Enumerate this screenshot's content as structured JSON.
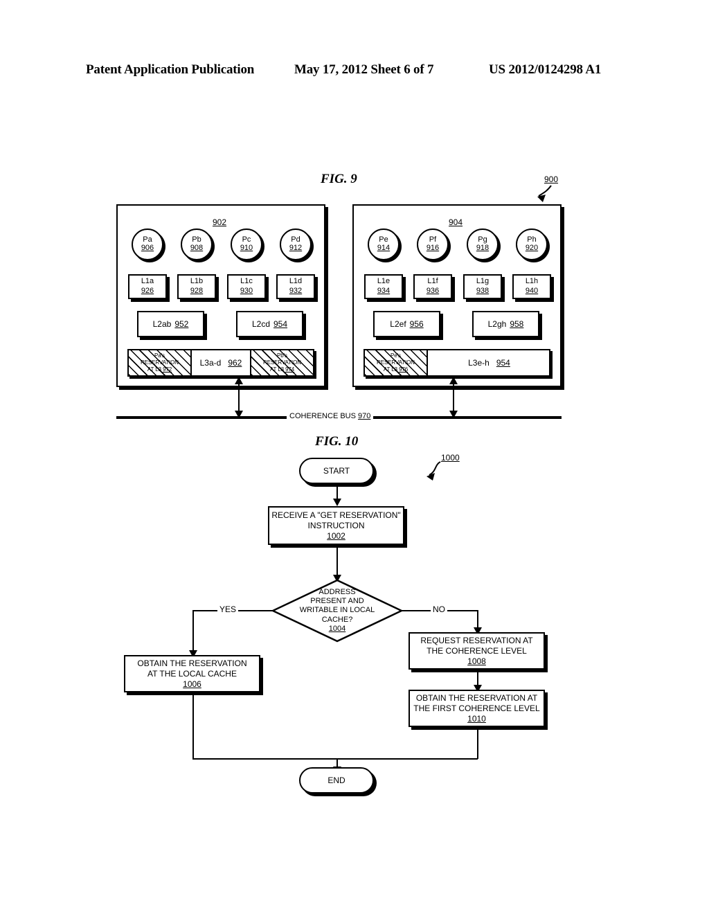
{
  "header": {
    "left": "Patent Application Publication",
    "center": "May 17, 2012  Sheet 6 of 7",
    "right": "US 2012/0124298 A1"
  },
  "fig9": {
    "title": "FIG. 9",
    "system_ref": "900",
    "clusters": [
      {
        "id": "902",
        "processors": [
          {
            "name": "Pa",
            "ref": "906"
          },
          {
            "name": "Pb",
            "ref": "908"
          },
          {
            "name": "Pc",
            "ref": "910"
          },
          {
            "name": "Pd",
            "ref": "912"
          }
        ],
        "l1_caches": [
          {
            "name": "L1a",
            "ref": "926"
          },
          {
            "name": "L1b",
            "ref": "928"
          },
          {
            "name": "L1c",
            "ref": "930"
          },
          {
            "name": "L1d",
            "ref": "932"
          }
        ],
        "l2_caches": [
          {
            "name": "L2ab",
            "ref": "952"
          },
          {
            "name": "L2cd",
            "ref": "954"
          }
        ],
        "l3_cache": {
          "name": "L3a-d",
          "ref": "962"
        },
        "reservations": [
          {
            "line1": "Pa's",
            "line2": "RESERVATION",
            "line3": "AT L3",
            "ref": "972"
          },
          {
            "line1": "Pb's",
            "line2": "RESERVATION",
            "line3": "AT L3",
            "ref": "974"
          }
        ]
      },
      {
        "id": "904",
        "processors": [
          {
            "name": "Pe",
            "ref": "914"
          },
          {
            "name": "Pf",
            "ref": "916"
          },
          {
            "name": "Pg",
            "ref": "918"
          },
          {
            "name": "Ph",
            "ref": "920"
          }
        ],
        "l1_caches": [
          {
            "name": "L1e",
            "ref": "934"
          },
          {
            "name": "L1f",
            "ref": "936"
          },
          {
            "name": "L1g",
            "ref": "938"
          },
          {
            "name": "L1h",
            "ref": "940"
          }
        ],
        "l2_caches": [
          {
            "name": "L2ef",
            "ref": "956"
          },
          {
            "name": "L2gh",
            "ref": "958"
          }
        ],
        "l3_cache": {
          "name": "L3e-h",
          "ref": "954"
        },
        "reservations": [
          {
            "line1": "Pe's",
            "line2": "RESERVATION",
            "line3": "AT L3",
            "ref": "976"
          }
        ]
      }
    ],
    "bus": {
      "label": "COHERENCE BUS",
      "ref": "970"
    }
  },
  "fig10": {
    "title": "FIG. 10",
    "flow_ref": "1000",
    "start": "START",
    "end": "END",
    "steps": [
      {
        "line1": "RECEIVE A \"GET RESERVATION\"",
        "line2": "INSTRUCTION",
        "ref": "1002"
      },
      {
        "line1": "OBTAIN THE RESERVATION",
        "line2": "AT THE LOCAL CACHE",
        "ref": "1006"
      },
      {
        "line1": "REQUEST RESERVATION AT",
        "line2": "THE COHERENCE LEVEL",
        "ref": "1008"
      },
      {
        "line1": "OBTAIN THE RESERVATION AT",
        "line2": "THE FIRST COHERENCE LEVEL",
        "ref": "1010"
      }
    ],
    "decision": {
      "line1": "ADDRESS",
      "line2": "PRESENT AND",
      "line3": "WRITABLE IN LOCAL",
      "line4": "CACHE?",
      "ref": "1004"
    },
    "branch_yes": "YES",
    "branch_no": "NO"
  }
}
